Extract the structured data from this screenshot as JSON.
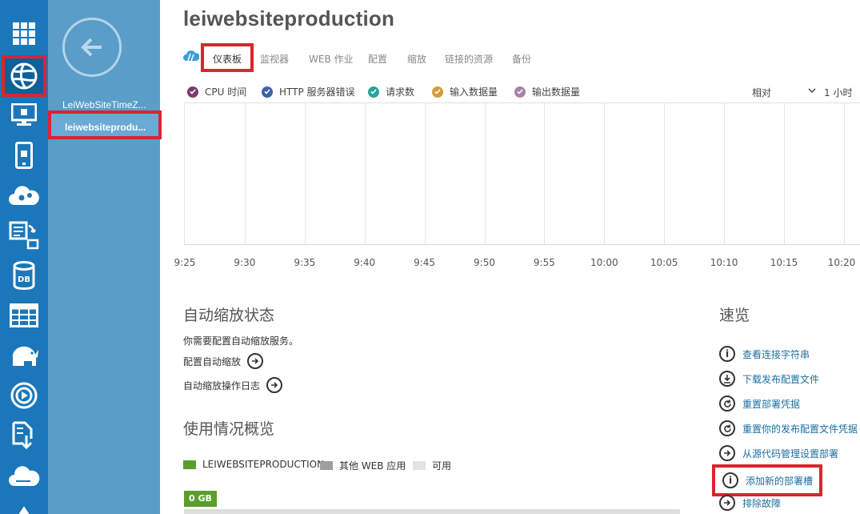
{
  "colors": {
    "rail_bg": "#1b77b9",
    "subnav_bg": "#5a9dc9",
    "highlight": "#d9252f",
    "link": "#1a6fa0",
    "cpu": "#7b3b6e",
    "http_errors": "#3f63a9",
    "requests": "#2aa39b",
    "data_in": "#d69a3a",
    "data_out": "#a883a3",
    "usage_this": "#5a9e2e",
    "usage_other": "#9e9e9e",
    "usage_available": "#e2e2e2"
  },
  "rail": {
    "icons": [
      "all-items-icon",
      "websites-icon",
      "virtual-machines-icon",
      "mobile-services-icon",
      "cloud-services-icon",
      "batch-icon",
      "sql-database-icon",
      "storage-icon",
      "hdinsight-icon",
      "media-services-icon",
      "service-bus-icon",
      "cloud-icon",
      "settings-icon"
    ]
  },
  "subnav": {
    "items": [
      "LeiWebSiteTimeZ...",
      "leiwebsiteprodu..."
    ]
  },
  "page": {
    "title": "leiwebsiteproduction"
  },
  "tabs": [
    "仪表板",
    "监视器",
    "WEB 作业",
    "配置",
    "缩放",
    "链接的资源",
    "备份"
  ],
  "metrics": [
    {
      "label": "CPU 时间",
      "color": "#7b3b6e"
    },
    {
      "label": "HTTP 服务器错误",
      "color": "#3f63a9"
    },
    {
      "label": "请求数",
      "color": "#2aa39b"
    },
    {
      "label": "输入数据量",
      "color": "#d69a3a"
    },
    {
      "label": "输出数据量",
      "color": "#a883a3"
    }
  ],
  "chart_controls": {
    "scale": "相对",
    "range": "1 小时"
  },
  "chart_data": {
    "type": "line",
    "categories": [
      "9:25",
      "9:30",
      "9:35",
      "9:40",
      "9:45",
      "9:50",
      "9:55",
      "10:00",
      "10:05",
      "10:10",
      "10:15",
      "10:20"
    ],
    "series": [],
    "grid": true
  },
  "autoscale": {
    "title": "自动缩放状态",
    "message": "你需要配置自动缩放服务。",
    "configure": "配置自动缩放",
    "log": "自动缩放操作日志"
  },
  "usage": {
    "title": "使用情况概览",
    "legend": [
      "LEIWEBSITEPRODUCTION",
      "其他 WEB 应用",
      "可用"
    ],
    "value": "0 GB"
  },
  "quick_glance": {
    "title": "速览",
    "links": [
      {
        "label": "查看连接字符串",
        "icon": "info-icon"
      },
      {
        "label": "下载发布配置文件",
        "icon": "download-icon"
      },
      {
        "label": "重置部署凭据",
        "icon": "reset-icon"
      },
      {
        "label": "重置你的发布配置文件凭据",
        "icon": "reset-icon"
      },
      {
        "label": "从源代码管理设置部署",
        "icon": "arrow-right-icon"
      },
      {
        "label": "添加新的部署槽",
        "icon": "info-icon"
      },
      {
        "label": "排除故障",
        "icon": "arrow-right-icon"
      }
    ]
  }
}
